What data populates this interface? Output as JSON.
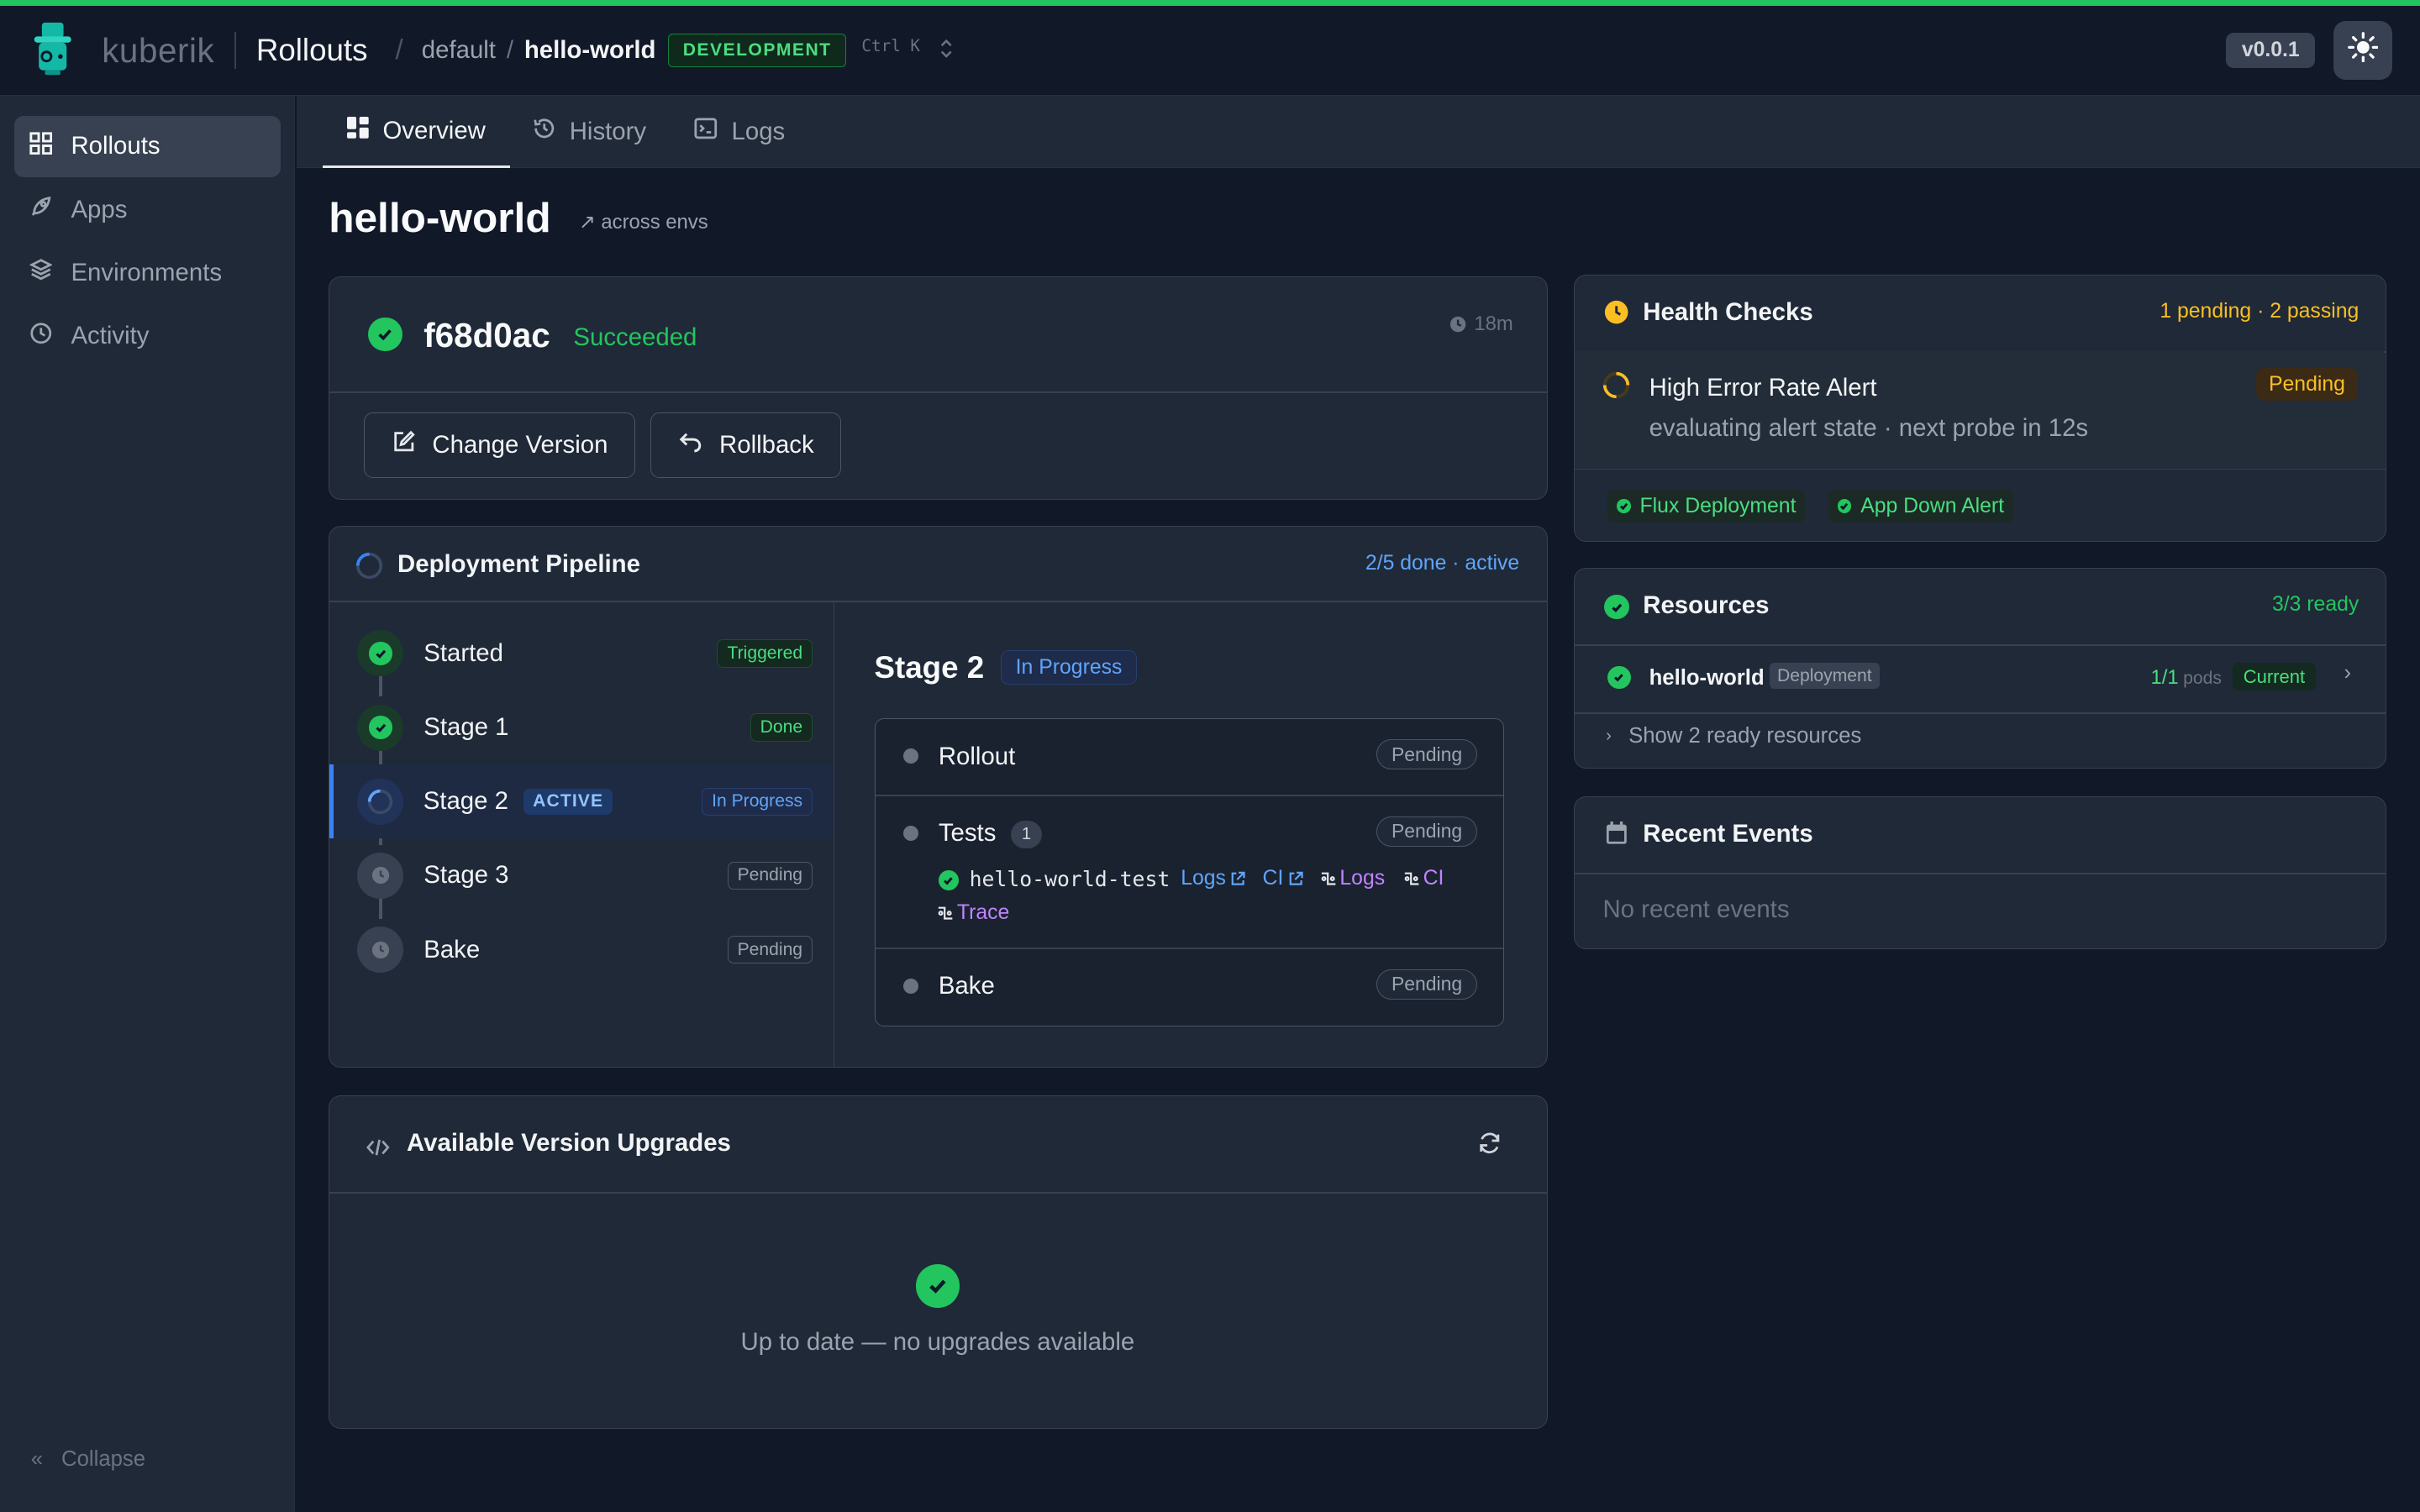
{
  "header": {
    "brand": "kuberik",
    "app_title": "Rollouts",
    "breadcrumb": {
      "namespace": "default",
      "current": "hello-world"
    },
    "env_badge": "DEVELOPMENT",
    "shortcut": "Ctrl K",
    "version": "v0.0.1"
  },
  "sidebar": {
    "items": [
      {
        "label": "Rollouts",
        "icon": "grid-icon",
        "active": true
      },
      {
        "label": "Apps",
        "icon": "rocket-icon",
        "active": false
      },
      {
        "label": "Environments",
        "icon": "layers-icon",
        "active": false
      },
      {
        "label": "Activity",
        "icon": "clock-icon",
        "active": false
      }
    ],
    "collapse_label": "Collapse"
  },
  "tabs": [
    {
      "label": "Overview",
      "icon": "dashboard-icon",
      "active": true
    },
    {
      "label": "History",
      "icon": "history-icon",
      "active": false
    },
    {
      "label": "Logs",
      "icon": "terminal-icon",
      "active": false
    }
  ],
  "page": {
    "title": "hello-world",
    "across_envs": "↗ across envs"
  },
  "commit": {
    "hash": "f68d0ac",
    "status": "Succeeded",
    "age": "18m",
    "change_version_label": "Change Version",
    "rollback_label": "Rollback"
  },
  "pipeline": {
    "title": "Deployment Pipeline",
    "summary": "2/5 done · active",
    "active_tag": "ACTIVE",
    "stages": [
      {
        "name": "Started",
        "status": "Triggered",
        "state": "done"
      },
      {
        "name": "Stage 1",
        "status": "Done",
        "state": "done"
      },
      {
        "name": "Stage 2",
        "status": "In Progress",
        "state": "active"
      },
      {
        "name": "Stage 3",
        "status": "Pending",
        "state": "pending"
      },
      {
        "name": "Bake",
        "status": "Pending",
        "state": "pending"
      }
    ],
    "detail": {
      "title": "Stage 2",
      "badge": "In Progress",
      "steps": [
        {
          "name": "Rollout",
          "status": "Pending"
        },
        {
          "name": "Tests",
          "status": "Pending",
          "count": "1"
        },
        {
          "name": "Bake",
          "status": "Pending"
        }
      ],
      "test": {
        "name": "hello-world-test",
        "links": [
          "Logs",
          "CI",
          "Logs",
          "CI",
          "Trace"
        ]
      }
    }
  },
  "upgrades": {
    "title": "Available Version Upgrades",
    "empty_message": "Up to date — no upgrades available"
  },
  "health_checks": {
    "title": "Health Checks",
    "summary": "1 pending · 2 passing",
    "pending_alert": {
      "name": "High Error Rate Alert",
      "detail": "evaluating alert state · next probe in 12s",
      "status": "Pending"
    },
    "passing": [
      "Flux Deployment",
      "App Down Alert"
    ]
  },
  "resources": {
    "title": "Resources",
    "summary": "3/3 ready",
    "items": [
      {
        "name": "hello-world",
        "kind": "Deployment",
        "pods": "1/1",
        "pods_unit": "pods",
        "status": "Current"
      }
    ],
    "show_more": "Show 2 ready resources"
  },
  "events": {
    "title": "Recent Events",
    "empty_message": "No recent events"
  },
  "colors": {
    "accent_green": "#22c55e",
    "accent_blue": "#3b82f6",
    "warning": "#fbbf24",
    "background": "#111827",
    "card": "#1f2937"
  }
}
